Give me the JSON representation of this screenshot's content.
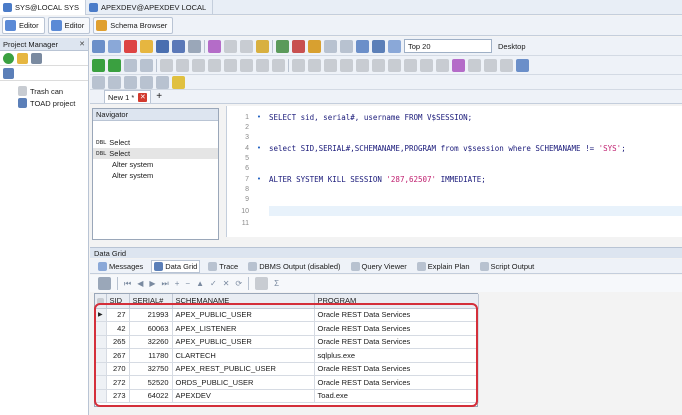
{
  "connections": [
    {
      "label": "SYS@LOCAL SYS",
      "active": true
    },
    {
      "label": "APEXDEV@APEXDEV LOCAL",
      "active": false
    }
  ],
  "view_tabs": [
    "Editor",
    "Editor",
    "Schema Browser"
  ],
  "project_manager": {
    "title": "Project Manager",
    "nodes": [
      "Trash can",
      "TOAD project"
    ]
  },
  "toolbar": {
    "top_select": "Top 20",
    "desktop_select": "Desktop"
  },
  "editor_tab": {
    "label": "New 1 *",
    "add": "+"
  },
  "navigator": {
    "title": "Navigator",
    "items": [
      {
        "badge": "DBL",
        "label": "Select"
      },
      {
        "badge": "DBL",
        "label": "Select"
      },
      {
        "badge": "",
        "label": "Alter system"
      },
      {
        "badge": "",
        "label": "Alter system"
      }
    ]
  },
  "editor": {
    "lines": [
      {
        "n": "1",
        "mark": "•",
        "code": "SELECT sid, serial#, username FROM V$SESSION;"
      },
      {
        "n": "2",
        "mark": "",
        "code": ""
      },
      {
        "n": "3",
        "mark": "",
        "code": ""
      },
      {
        "n": "4",
        "mark": "•",
        "code": "select SID,SERIAL#,SCHEMANAME,PROGRAM from v$session where SCHEMANAME != ",
        "str": "'SYS'",
        "tail": ";"
      },
      {
        "n": "5",
        "mark": "",
        "code": ""
      },
      {
        "n": "6",
        "mark": "",
        "code": ""
      },
      {
        "n": "7",
        "mark": "•",
        "code": "ALTER SYSTEM KILL SESSION ",
        "str": "'287,62507'",
        "tail": " IMMEDIATE;"
      },
      {
        "n": "8",
        "mark": "",
        "code": ""
      },
      {
        "n": "9",
        "mark": "",
        "code": ""
      },
      {
        "n": "10",
        "mark": "",
        "code": ""
      },
      {
        "n": "11",
        "mark": "",
        "code": ""
      }
    ]
  },
  "data_grid": {
    "title": "Data Grid",
    "tabs": [
      "Messages",
      "Data Grid",
      "Trace",
      "DBMS Output (disabled)",
      "Query Viewer",
      "Explain Plan",
      "Script Output"
    ],
    "tool_sigma": "Σ",
    "columns": [
      "SID",
      "SERIAL#",
      "SCHEMANAME",
      "PROGRAM"
    ],
    "rows": [
      [
        "27",
        "21993",
        "APEX_PUBLIC_USER",
        "Oracle REST Data Services"
      ],
      [
        "42",
        "60063",
        "APEX_LISTENER",
        "Oracle REST Data Services"
      ],
      [
        "265",
        "32260",
        "APEX_PUBLIC_USER",
        "Oracle REST Data Services"
      ],
      [
        "267",
        "11780",
        "CLARTECH",
        "sqlplus.exe"
      ],
      [
        "270",
        "32750",
        "APEX_REST_PUBLIC_USER",
        "Oracle REST Data Services"
      ],
      [
        "272",
        "52520",
        "ORDS_PUBLIC_USER",
        "Oracle REST Data Services"
      ],
      [
        "273",
        "64022",
        "APEXDEV",
        "Toad.exe"
      ]
    ]
  },
  "colors": {
    "highlight": "#d42f3a",
    "keyword": "#1a1a7a",
    "string": "#c02070"
  }
}
